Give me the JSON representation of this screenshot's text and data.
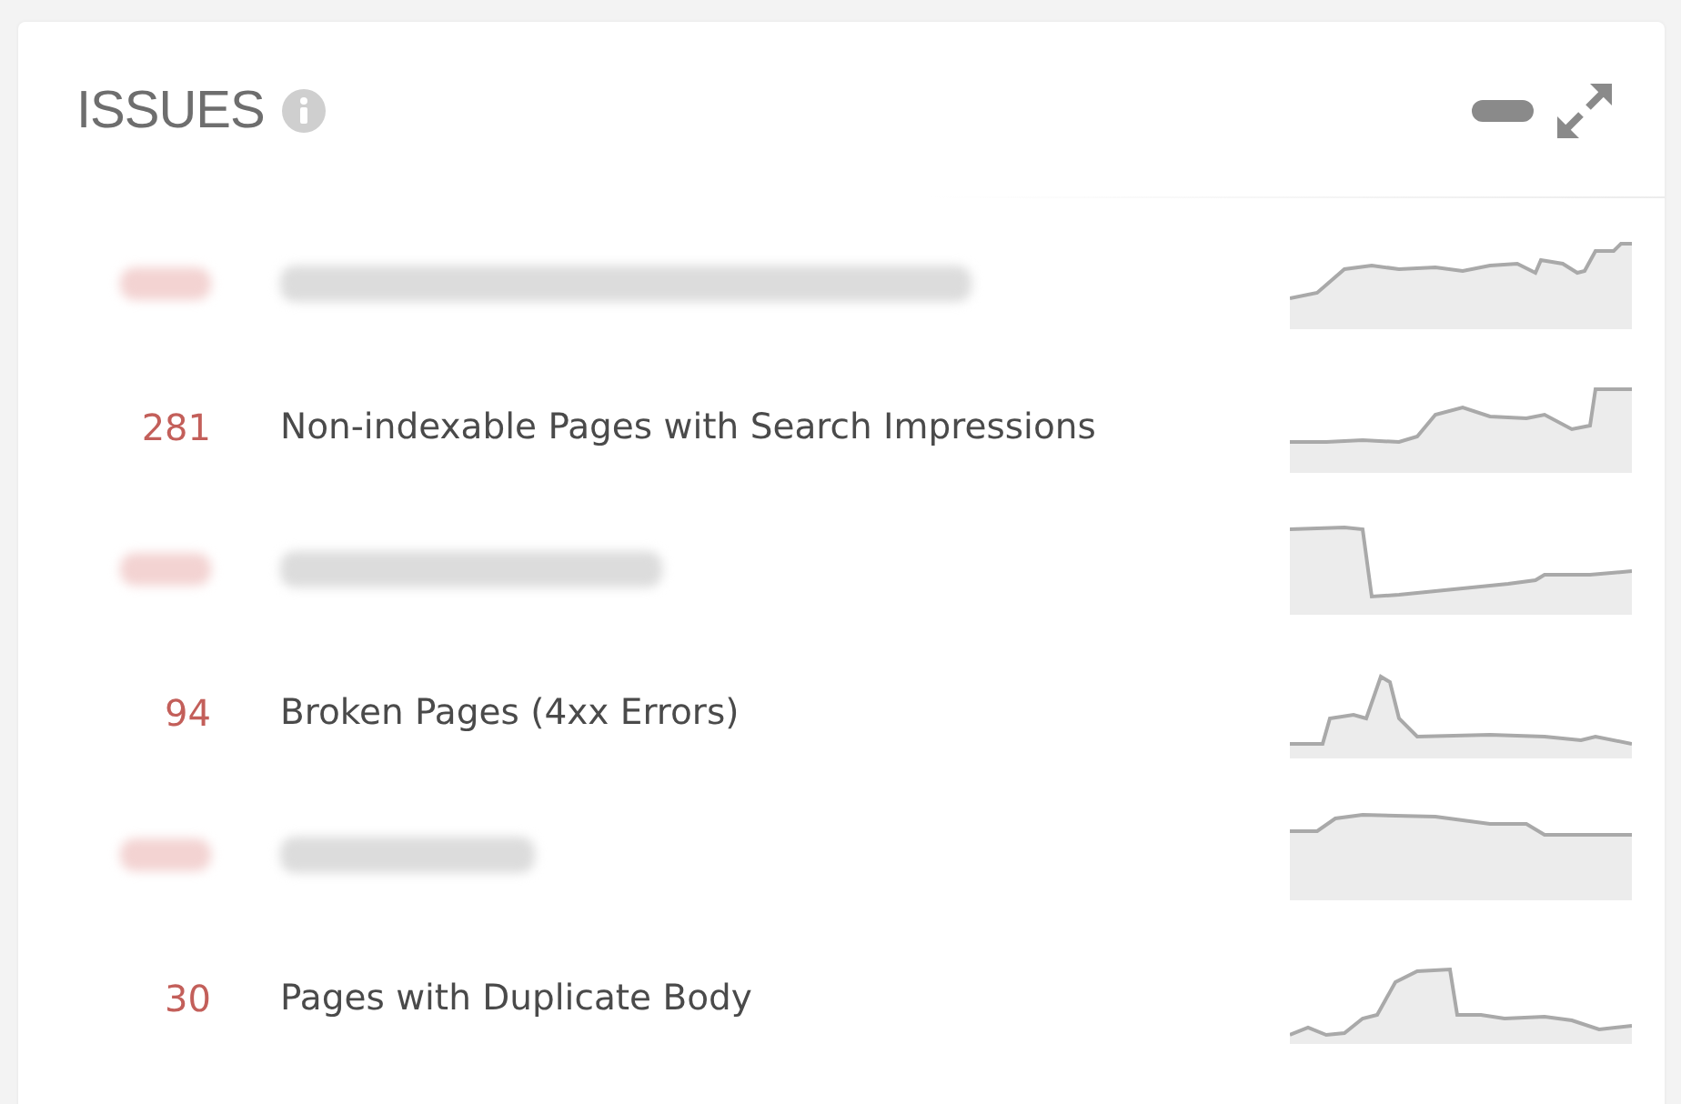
{
  "widget": {
    "title": "ISSUES"
  },
  "issues": [
    {
      "blurred": true
    },
    {
      "count": "281",
      "label": "Non-indexable Pages with Search Impressions",
      "blurred": false
    },
    {
      "blurred": true
    },
    {
      "count": "94",
      "label": "Broken Pages (4xx Errors)",
      "blurred": false
    },
    {
      "blurred": true
    },
    {
      "count": "30",
      "label": "Pages with Duplicate Body",
      "blurred": false
    }
  ]
}
